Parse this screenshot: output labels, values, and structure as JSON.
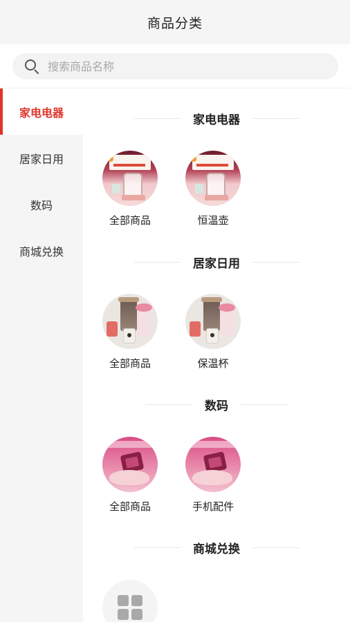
{
  "nav": {
    "title": "商品分类"
  },
  "search": {
    "placeholder": "搜索商品名称"
  },
  "sidebar": {
    "items": [
      {
        "label": "家电电器",
        "active": true
      },
      {
        "label": "居家日用",
        "active": false
      },
      {
        "label": "数码",
        "active": false
      },
      {
        "label": "商城兑换",
        "active": false
      }
    ]
  },
  "sections": [
    {
      "title": "家电电器",
      "tiles": [
        {
          "label": "全部商品"
        },
        {
          "label": "恒温壶"
        }
      ]
    },
    {
      "title": "居家日用",
      "tiles": [
        {
          "label": "全部商品"
        },
        {
          "label": "保温杯"
        }
      ]
    },
    {
      "title": "数码",
      "tiles": [
        {
          "label": "全部商品"
        },
        {
          "label": "手机配件"
        }
      ]
    },
    {
      "title": "商城兑换",
      "tiles": [
        {
          "label": ""
        }
      ]
    }
  ],
  "colors": {
    "accent": "#e0352b",
    "sidebar_bg": "#f5f5f5",
    "nav_bg": "#f5f5f5"
  },
  "icons": {
    "search": "search-icon",
    "placeholder": "grid-placeholder-icon"
  }
}
